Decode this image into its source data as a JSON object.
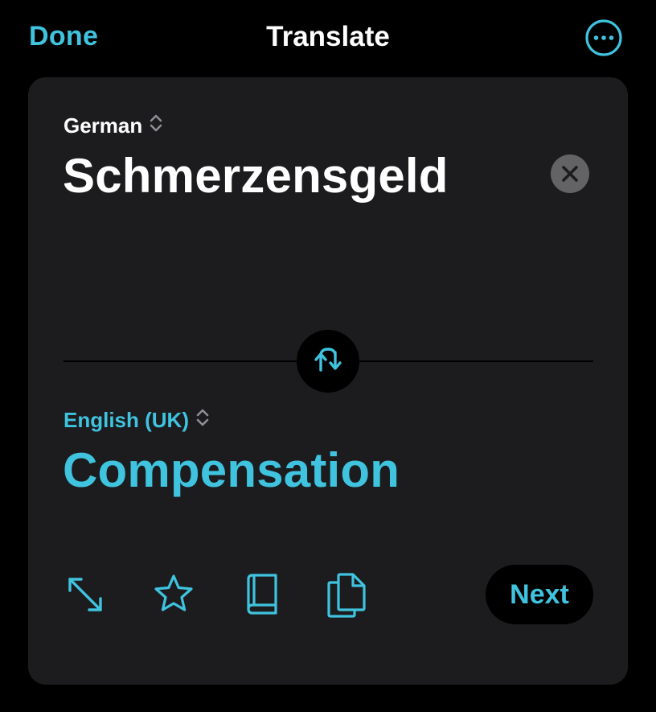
{
  "nav": {
    "done_label": "Done",
    "title": "Translate",
    "more_icon": "ellipsis-circle-icon"
  },
  "source": {
    "language": "German",
    "text": "Schmerzensgeld",
    "clear_icon": "xmark-circle-icon"
  },
  "swap_icon": "swap-arrows-icon",
  "target": {
    "language": "English (UK)",
    "text": "Compensation"
  },
  "toolbar": {
    "expand_icon": "expand-arrows-icon",
    "favorite_icon": "star-icon",
    "dictionary_icon": "book-icon",
    "copy_icon": "copy-documents-icon",
    "next_label": "Next"
  },
  "colors": {
    "background": "#000000",
    "card": "#1c1c1e",
    "accent": "#3fc3de",
    "text": "#ffffff",
    "clear_button": "#636366"
  }
}
